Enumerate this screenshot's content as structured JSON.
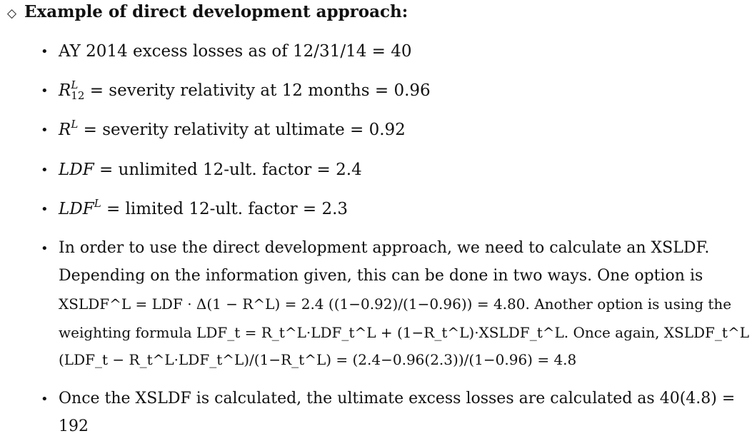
{
  "heading": {
    "marker": "◇",
    "title": "Example of direct development approach:"
  },
  "bullet_glyph": "•",
  "items": [
    {
      "lines": [
        "AY 2014 excess losses as of 12/31/14 = 40"
      ]
    },
    {
      "lines": [
        "R",
        "L",
        "12",
        " = severity relativity at 12 months = 0.96"
      ]
    },
    {
      "lines": [
        "R",
        "L",
        " = severity relativity at ultimate = 0.92"
      ]
    },
    {
      "lines": [
        "LDF",
        " = unlimited 12-ult. factor = 2.4"
      ]
    },
    {
      "lines": [
        "LDF",
        "L",
        " = limited 12-ult. factor = 2.3"
      ]
    },
    {
      "lines": [
        "In order to use the direct development approach, we need to calculate an XSLDF.",
        "Depending on the information given, this can be done in two ways.  One option is",
        "XSLDF^L = LDF · Δ(1 − R^L) = 2.4 ((1−0.92)/(1−0.96)) = 4.80.  Another option is using the",
        "weighting formula LDF_t = R_t^L·LDF_t^L + (1−R_t^L)·XSLDF_t^L. Once again, XSLDF_t^L =",
        "(LDF_t − R_t^L·LDF_t^L)/(1−R_t^L) = (2.4−0.96(2.3))/(1−0.96) = 4.8"
      ]
    },
    {
      "lines": [
        "Once the XSLDF is calculated, the ultimate excess losses are calculated as 40(4.8) =",
        "192"
      ]
    }
  ]
}
